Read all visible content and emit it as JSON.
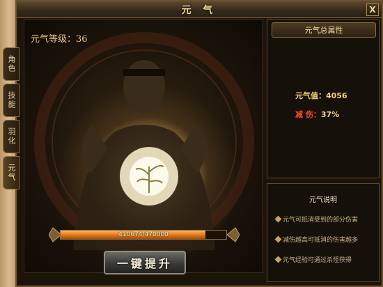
{
  "window": {
    "title": "元 气",
    "close_label": "X"
  },
  "tabs": [
    {
      "label": "角色",
      "active": false
    },
    {
      "label": "技能",
      "active": false
    },
    {
      "label": "羽化",
      "active": false
    },
    {
      "label": "元气",
      "active": true
    }
  ],
  "level": {
    "label": "元气等级：36"
  },
  "progress": {
    "text": "410674/470000",
    "fraction": 0.873
  },
  "upgrade_button": {
    "label": "一键提升"
  },
  "attributes": {
    "header": "元气总属性",
    "value_label": "元气值：",
    "value": "4056",
    "reduce_label": "减  伤：",
    "reduce_value": "37%"
  },
  "info": {
    "title": "元气说明",
    "items": [
      "元气可抵消受到的部分伤害",
      "减伤越高可抵消的伤害越多",
      "元气经验可通过杀怪获得"
    ]
  },
  "colors": {
    "accent": "#f0d893",
    "reduce": "#ff4a2e",
    "progress": "#e0761b"
  }
}
